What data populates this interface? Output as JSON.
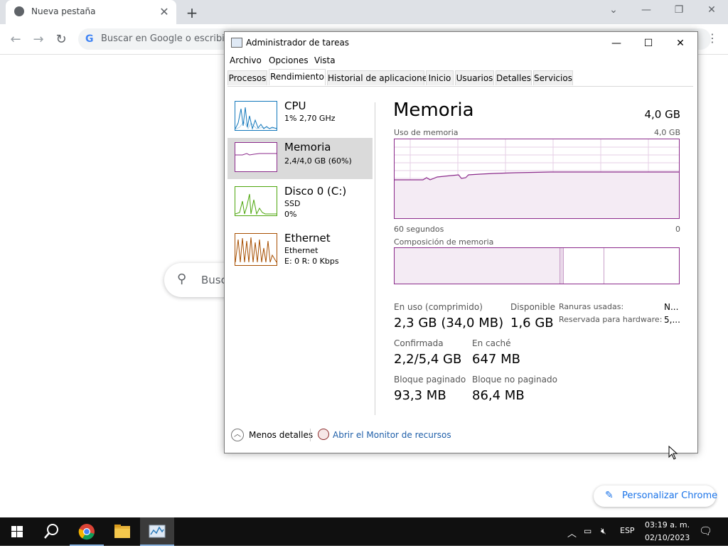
{
  "chrome": {
    "tab_title": "Nueva pestaña",
    "omnibox_placeholder": "Buscar en Google o escribir",
    "ntp_search_placeholder": "Busc",
    "customize_label": "Personalizar Chrome"
  },
  "task_manager": {
    "title": "Administrador de tareas",
    "menu": [
      "Archivo",
      "Opciones",
      "Vista"
    ],
    "tabs": [
      "Procesos",
      "Rendimiento",
      "Historial de aplicaciones",
      "Inicio",
      "Usuarios",
      "Detalles",
      "Servicios"
    ],
    "active_tab": "Rendimiento",
    "sidebar": [
      {
        "name": "CPU",
        "sub1": "1% 2,70 GHz",
        "sub2": "",
        "color": "#1177bb"
      },
      {
        "name": "Memoria",
        "sub1": "2,4/4,0 GB (60%)",
        "sub2": "",
        "color": "#8b2a8b"
      },
      {
        "name": "Disco 0 (C:)",
        "sub1": "SSD",
        "sub2": "0%",
        "color": "#4da60c"
      },
      {
        "name": "Ethernet",
        "sub1": "Ethernet",
        "sub2": "E: 0 R: 0 Kbps",
        "color": "#a74f01"
      }
    ],
    "detail": {
      "title": "Memoria",
      "total": "4,0 GB",
      "usage_label": "Uso de memoria",
      "usage_max": "4,0 GB",
      "time_label": "60 segundos",
      "time_end": "0",
      "composition_label": "Composición de memoria",
      "stats": {
        "in_use_label": "En uso (comprimido)",
        "in_use_value": "2,3 GB (34,0 MB)",
        "available_label": "Disponible",
        "available_value": "1,6 GB",
        "committed_label": "Confirmada",
        "committed_value": "2,2/5,4 GB",
        "cached_label": "En caché",
        "cached_value": "647 MB",
        "paged_label": "Bloque paginado",
        "paged_value": "93,3 MB",
        "nonpaged_label": "Bloque no paginado",
        "nonpaged_value": "86,4 MB",
        "slots_label": "Ranuras usadas:",
        "slots_value": "N...",
        "reserved_label": "Reservada para hardware:",
        "reserved_value": "5,..."
      }
    },
    "footer": {
      "less_details": "Menos detalles",
      "resource_monitor": "Abrir el Monitor de recursos"
    }
  },
  "taskbar": {
    "language": "ESP",
    "time": "03:19 a. m.",
    "date": "02/10/2023"
  },
  "colors": {
    "memory_accent": "#8b2a8b",
    "link": "#1f5fa9",
    "taskbar": "#101010"
  }
}
